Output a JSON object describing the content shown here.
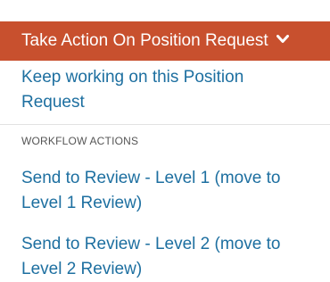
{
  "menu": {
    "title": "Take Action On Position Request",
    "title_icon": "chevron-down-icon",
    "keep_working": "Keep working on this Position Request",
    "section_label": "WORKFLOW ACTIONS",
    "actions": [
      "Send to Review - Level 1 (move to Level 1 Review)",
      "Send to Review - Level 2 (move to Level 2 Review)"
    ]
  },
  "colors": {
    "header_bg": "#c8502e",
    "header_text": "#ffffff",
    "link": "#1d6fa0",
    "section_label": "#555555",
    "divider": "#e2e2e2"
  }
}
